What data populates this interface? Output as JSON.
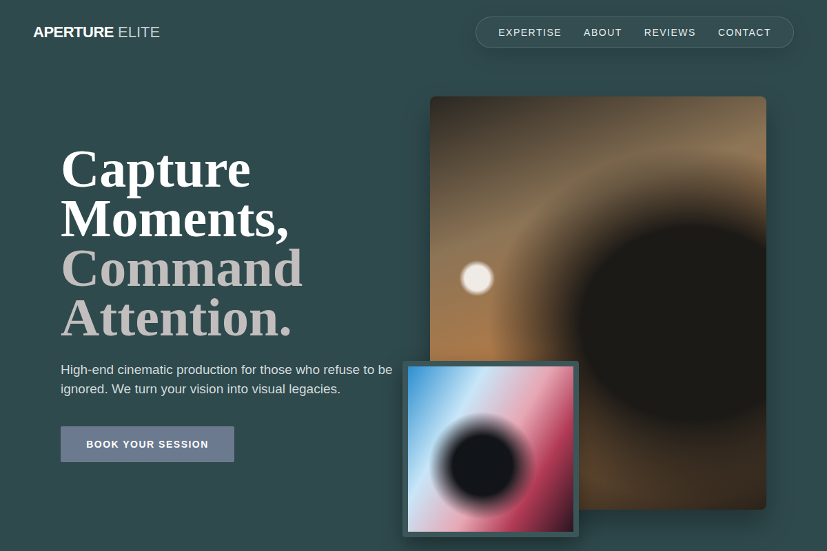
{
  "logo": {
    "primary": "APERTURE",
    "secondary": "ELITE"
  },
  "nav": {
    "items": [
      {
        "label": "EXPERTISE"
      },
      {
        "label": "ABOUT"
      },
      {
        "label": "REVIEWS"
      },
      {
        "label": "CONTACT"
      }
    ]
  },
  "hero": {
    "headline": [
      {
        "text": "Capture",
        "muted": false
      },
      {
        "text": "Moments,",
        "muted": false
      },
      {
        "text": "Command",
        "muted": true
      },
      {
        "text": "Attention.",
        "muted": true
      }
    ],
    "description": "High-end cinematic production for those who refuse to be ignored. We turn your vision into visual legacies.",
    "cta": "BOOK YOUR SESSION"
  }
}
